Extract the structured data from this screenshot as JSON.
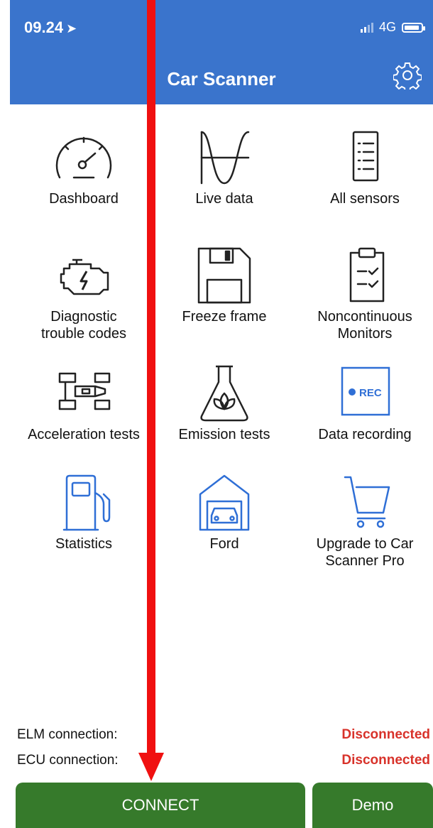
{
  "status_bar": {
    "time": "09.24",
    "network": "4G"
  },
  "header": {
    "title": "Car Scanner"
  },
  "tiles": [
    {
      "label": "Dashboard",
      "icon": "speedometer-icon"
    },
    {
      "label": "Live data",
      "icon": "wave-icon"
    },
    {
      "label": "All sensors",
      "icon": "list-icon"
    },
    {
      "label": "Diagnostic\ntrouble codes",
      "icon": "engine-icon"
    },
    {
      "label": "Freeze frame",
      "icon": "floppy-icon"
    },
    {
      "label": "Noncontinuous\nMonitors",
      "icon": "clipboard-icon"
    },
    {
      "label": "Acceleration tests",
      "icon": "racecar-icon"
    },
    {
      "label": "Emission tests",
      "icon": "flask-icon"
    },
    {
      "label": "Data recording",
      "icon": "rec-icon",
      "icon_text": "REC"
    },
    {
      "label": "Statistics",
      "icon": "fuel-pump-icon"
    },
    {
      "label": "Ford",
      "icon": "garage-icon"
    },
    {
      "label": "Upgrade to Car\nScanner Pro",
      "icon": "cart-icon"
    }
  ],
  "connections": {
    "elm": {
      "label": "ELM connection:",
      "status": "Disconnected"
    },
    "ecu": {
      "label": "ECU connection:",
      "status": "Disconnected"
    }
  },
  "buttons": {
    "connect": "CONNECT",
    "demo": "Demo"
  },
  "colors": {
    "header": "#3a74cc",
    "accent_blue": "#2f6fd6",
    "button_green": "#367a2b",
    "disconnected_red": "#d8322a",
    "annotation_arrow": "#f01010"
  }
}
